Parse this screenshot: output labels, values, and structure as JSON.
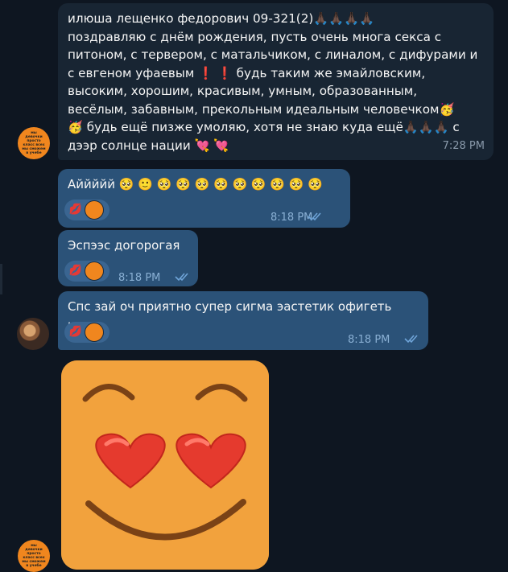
{
  "messages": [
    {
      "id": "m1",
      "direction": "in",
      "line1": "илюша лещенко федорович 09-321(2)🙏🏿🙏🏿🙏🏿🙏🏿",
      "line2": "поздравляю с днём рождения, пусть очень многа секса с",
      "line3": "питоном, с тервером, с матальчиком, с линалом, с дифурами и",
      "line4": "с евгеном уфаевым ❗ ❗ будь таким же эмайловским,",
      "line5": "высоким, хорошим, красивым, умным, образованным,",
      "line6": "весёлым, забавным, прекольным идеальным человечком🥳",
      "line7": "🥳 будь ещё пизже умоляю, хотя не знаю куда ещё🙏🏿🙏🏿🙏🏿 с",
      "line8": "дээр солнце нации 💘 💘",
      "time": "7:28 PM"
    },
    {
      "id": "m2",
      "direction": "out",
      "text": "Аййййй 🥺 🙂 🥺 🥺 🥺 🥺 🥺 🥺 🥺 🥺 🥺",
      "reaction": "💋",
      "time": "8:18 PM"
    },
    {
      "id": "m3",
      "direction": "out",
      "text": "Эспээс догорогая",
      "reaction": "💋",
      "time": "8:18 PM"
    },
    {
      "id": "m4",
      "direction": "out",
      "text": "Спс зай оч приятно супер сигма эастетик офигеть круто",
      "reaction": "💋",
      "time": "8:18 PM"
    }
  ],
  "avatar_text": "мы девочки просто класс всех мы сможем в учебе",
  "sticker": {
    "name": "heart-eyes-smiley-sticker"
  },
  "colors": {
    "background": "#0e1621",
    "incoming_bubble": "#182533",
    "outgoing_bubble": "#2b5278",
    "sticker": "#f2a23d",
    "avatar": "#f0861e"
  }
}
